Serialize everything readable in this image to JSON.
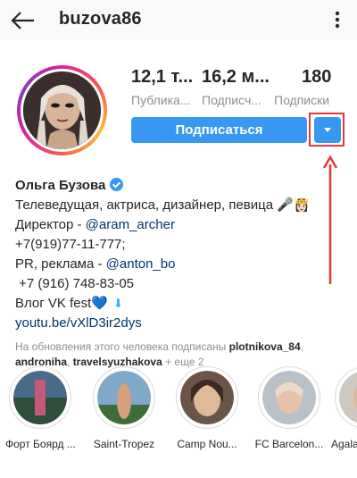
{
  "header": {
    "username": "buzova86",
    "back_icon": "arrow-left-icon",
    "more_icon": "more-vertical-icon"
  },
  "stats": [
    {
      "value": "12,1 т...",
      "label": "Публика..."
    },
    {
      "value": "16,2 м...",
      "label": "Подписч..."
    },
    {
      "value": "180",
      "label": "Подписки"
    }
  ],
  "actions": {
    "follow_label": "Подписаться",
    "dropdown_icon": "caret-down-icon"
  },
  "bio": {
    "name": "Ольга Бузова",
    "line1": "Телеведущая, актриса, дизайнер, певица 🎤👸🏻",
    "line2_prefix": "Директор - ",
    "line2_link": "@aram_archer",
    "line3": "+7(919)77-11-777;",
    "line4_prefix": "PR, реклама - ",
    "line4_link": "@anton_bo",
    "line5": " +7 (916) 748-83-05",
    "line6_prefix": "Влог VK fest",
    "line6_heart": "💙",
    "line6_arrow": "⬇",
    "website": "youtu.be/vXlD3ir2dys"
  },
  "followed_by": {
    "prefix": "На обновления этого человека подписаны ",
    "user1": "plotnikova_84",
    "sep1": ",",
    "user2": "andronіha",
    "sep2": ", ",
    "user3": "travelsyuzhakova",
    "suffix": " + еще 2"
  },
  "highlights": [
    {
      "label": "Форт Боярд ..."
    },
    {
      "label": "Saint-Tropez"
    },
    {
      "label": "Camp Nou..."
    },
    {
      "label": "FC Barcelon..."
    },
    {
      "label": "Agala"
    }
  ],
  "colors": {
    "accent": "#3897f0",
    "annotation_red": "#e53935"
  }
}
